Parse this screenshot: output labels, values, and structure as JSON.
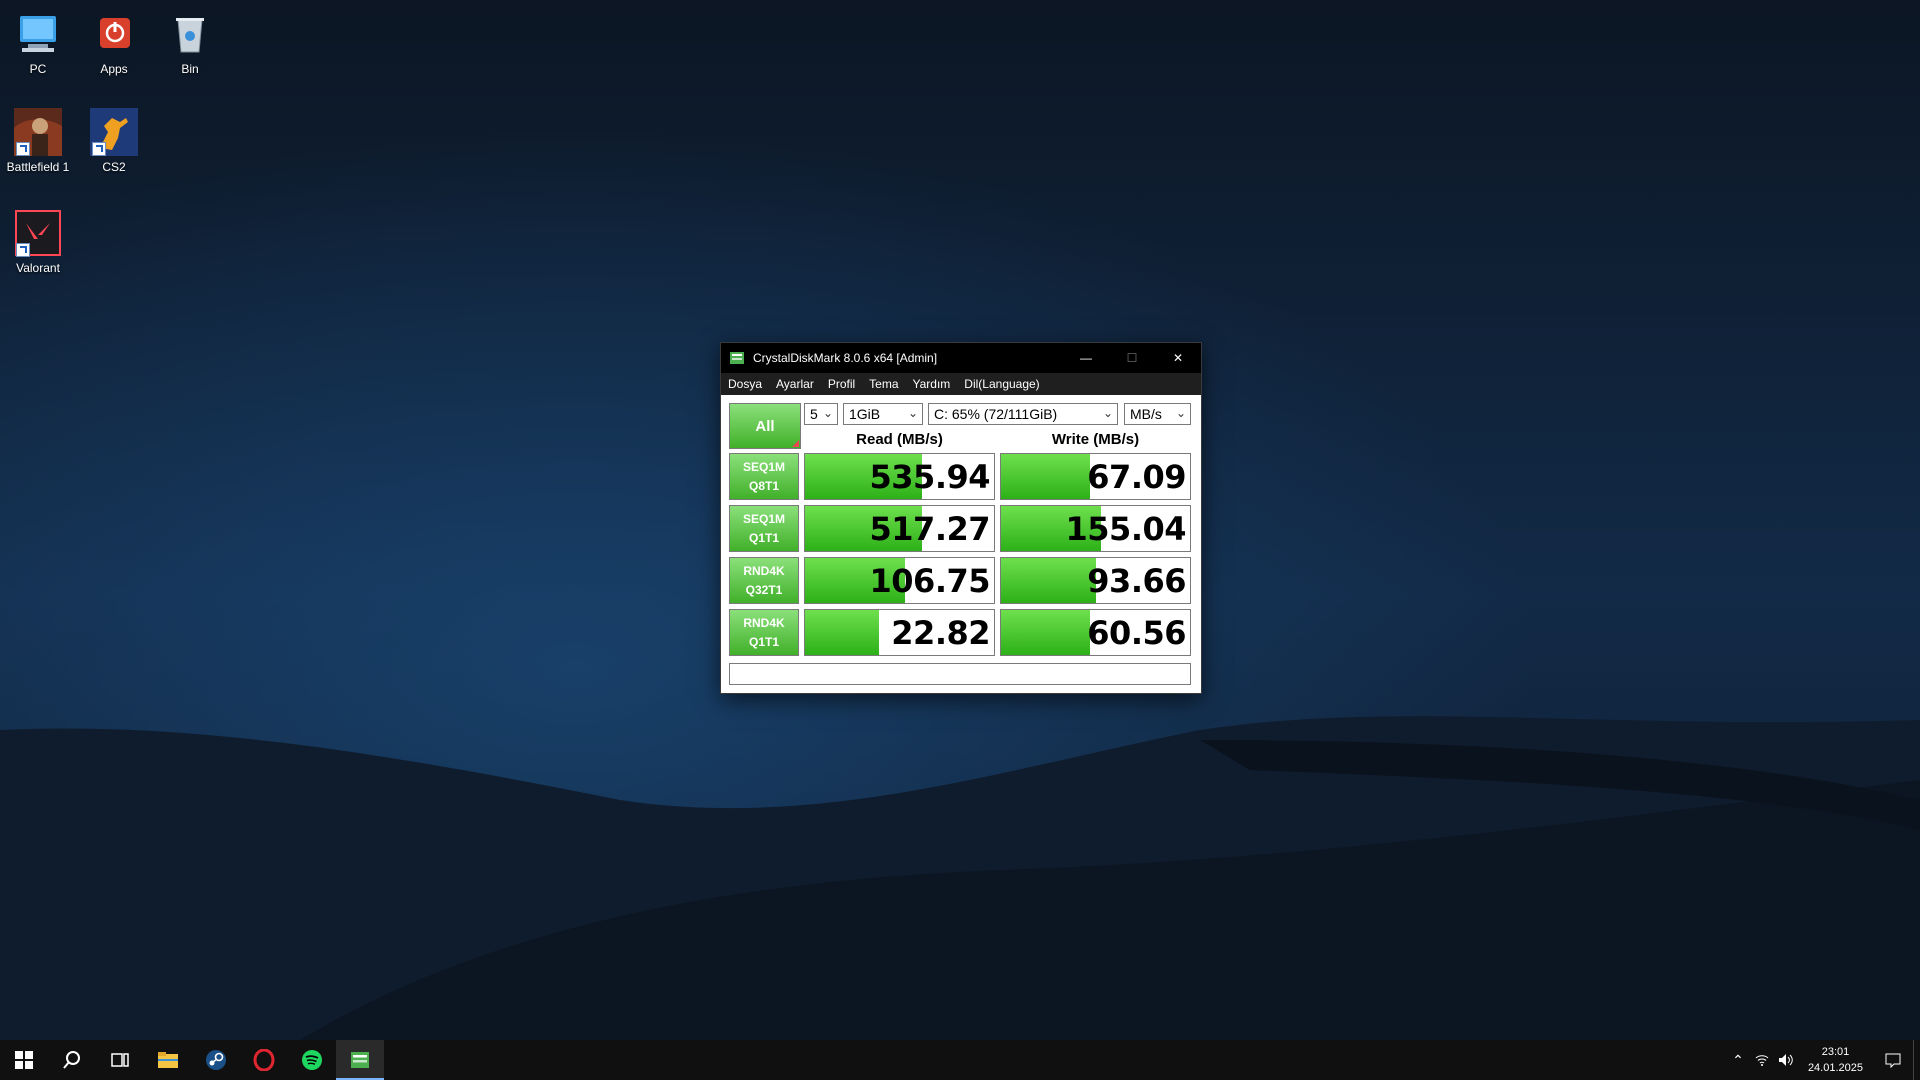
{
  "desktop": {
    "icons": [
      {
        "label": "PC"
      },
      {
        "label": "Apps"
      },
      {
        "label": "Bin"
      },
      {
        "label": "Battlefield 1"
      },
      {
        "label": "CS2"
      },
      {
        "label": "Valorant"
      }
    ]
  },
  "window": {
    "title": "CrystalDiskMark 8.0.6 x64 [Admin]",
    "controls": {
      "minimize": "—",
      "maximize": "☐",
      "close": "✕"
    },
    "menu": [
      "Dosya",
      "Ayarlar",
      "Profil",
      "Tema",
      "Yardım",
      "Dil(Language)"
    ],
    "all_button": "All",
    "count_select": "5",
    "size_select": "1GiB",
    "drive_select": "C: 65% (72/111GiB)",
    "unit_select": "MB/s",
    "read_header": "Read (MB/s)",
    "write_header": "Write (MB/s)",
    "rows": [
      {
        "line1": "SEQ1M",
        "line2": "Q8T1",
        "read": "535.94",
        "write": "67.09",
        "read_fill": 0.62,
        "write_fill": 0.47
      },
      {
        "line1": "SEQ1M",
        "line2": "Q1T1",
        "read": "517.27",
        "write": "155.04",
        "read_fill": 0.62,
        "write_fill": 0.53
      },
      {
        "line1": "RND4K",
        "line2": "Q32T1",
        "read": "106.75",
        "write": "93.66",
        "read_fill": 0.53,
        "write_fill": 0.5
      },
      {
        "line1": "RND4K",
        "line2": "Q1T1",
        "read": "22.82",
        "write": "60.56",
        "read_fill": 0.39,
        "write_fill": 0.47
      }
    ],
    "status": ""
  },
  "taskbar": {
    "apps": [
      "start-icon",
      "search-icon",
      "task-view-icon",
      "file-explorer-icon",
      "steam-icon",
      "opera-icon",
      "spotify-icon",
      "crystaldiskmark-icon"
    ],
    "time": "23:01",
    "date": "24.01.2025"
  }
}
